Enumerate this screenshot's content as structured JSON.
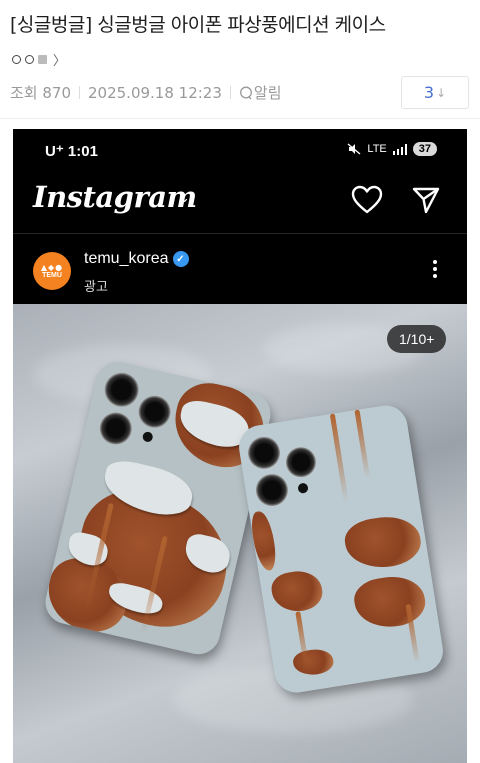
{
  "post": {
    "title": "[싱글벙글] 싱글벙글 아이폰 파상풍에디션 케이스",
    "views_label": "조회 870",
    "datetime": "2025.09.18 12:23",
    "alarm_label": "알림",
    "comment_count": "3",
    "comment_arrow": "↓"
  },
  "screenshot": {
    "carrier": "U⁺ 1:01",
    "network": "LTE",
    "battery": "37",
    "app_logo": "Instagram",
    "account": "temu_korea",
    "sponsored_label": "광고",
    "avatar_text": "TEMU",
    "page_indicator": "1/10+"
  },
  "icons": {
    "board": "board-chevron-icon",
    "alarm": "bell-icon",
    "heart": "heart-icon",
    "send": "send-icon",
    "verified": "verified-icon",
    "more": "more-options-icon"
  },
  "colors": {
    "comment_count": "#4a6fd1",
    "temu_orange": "#f58220",
    "verified_blue": "#3897f0",
    "meta_gray": "#9a9a9a"
  }
}
